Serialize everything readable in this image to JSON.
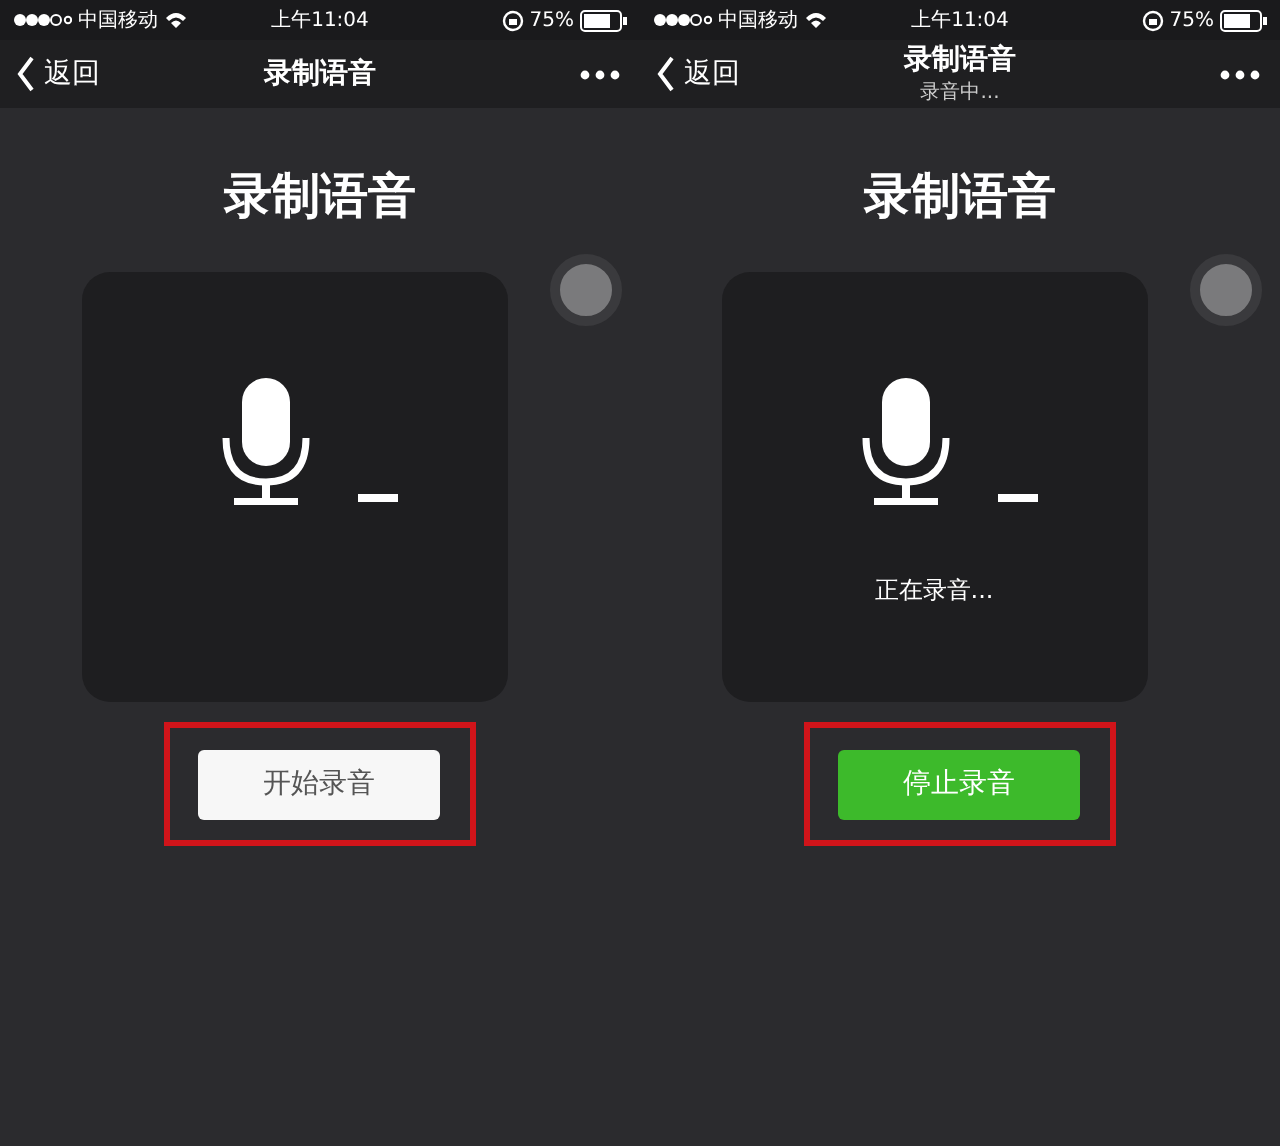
{
  "screens": [
    {
      "status_bar": {
        "carrier": "中国移动",
        "time": "上午11:04",
        "battery": "75%"
      },
      "nav": {
        "back": "返回",
        "title": "录制语音"
      },
      "heading": "录制语音",
      "button": {
        "label": "开始录音",
        "kind": "start"
      },
      "highlighted": true
    },
    {
      "status_bar": {
        "carrier": "中国移动",
        "time": "上午11:04",
        "battery": "75%"
      },
      "nav": {
        "back": "返回",
        "title": "录制语音",
        "subtitle": "录音中..."
      },
      "heading": "录制语音",
      "status_text": "正在录音...",
      "button": {
        "label": "停止录音",
        "kind": "stop"
      },
      "highlighted": true
    }
  ]
}
